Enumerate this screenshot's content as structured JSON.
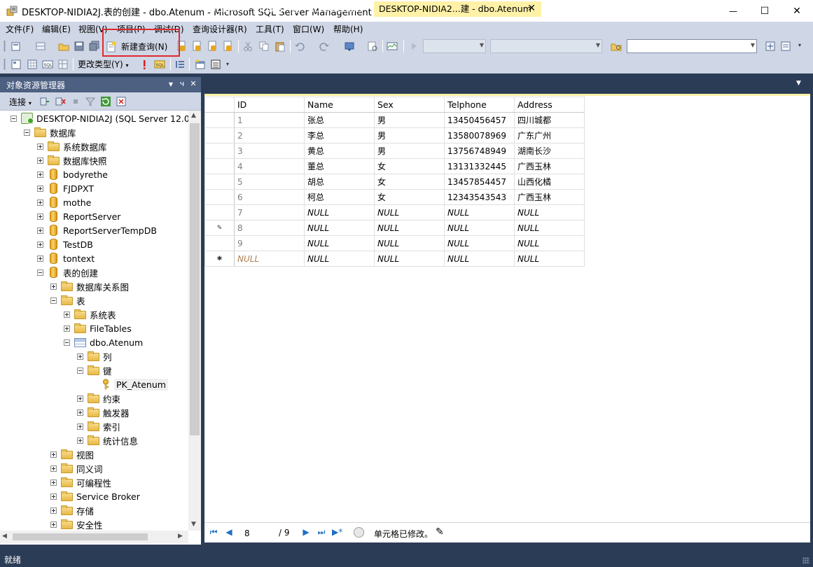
{
  "window": {
    "title": "DESKTOP-NIDIA2J.表的创建 - dbo.Atenum - Microsoft SQL Server Management Studio",
    "minimize": "—",
    "maximize": "☐",
    "close": "✕"
  },
  "menu": [
    "文件(F)",
    "编辑(E)",
    "视图(V)",
    "项目(P)",
    "调试(D)",
    "查询设计器(R)",
    "工具(T)",
    "窗口(W)",
    "帮助(H)"
  ],
  "toolbar": {
    "new_query": "新建查询(N)",
    "change_type": "更改类型(Y)"
  },
  "object_explorer": {
    "title": "对象资源管理器",
    "connect": "连接",
    "pin": "ч",
    "close": "✕",
    "server": "DESKTOP-NIDIA2J (SQL Server 12.0.2",
    "databases": "数据库",
    "system_databases": "系统数据库",
    "db_snapshots": "数据库快照",
    "db_list": [
      "bodyrethe",
      "FJDPXT",
      "mothe",
      "ReportServer",
      "ReportServerTempDB",
      "TestDB",
      "tontext"
    ],
    "current_db": "表的创建",
    "db_diagrams": "数据库关系图",
    "tables": "表",
    "system_tables": "系统表",
    "file_tables": "FileTables",
    "table_name": "dbo.Atenum",
    "columns": "列",
    "keys": "键",
    "pk": "PK_Atenum",
    "constraints": "约束",
    "triggers": "触发器",
    "indexes": "索引",
    "statistics": "统计信息",
    "views": "视图",
    "synonyms": "同义词",
    "programmability": "可编程性",
    "service_broker": "Service Broker",
    "storage": "存储",
    "security": "安全性"
  },
  "tabs": {
    "inactive": "DESKTOP-NIDIA2...建 - dbo.Atenum",
    "active": "DESKTOP-NIDIA2...建 - dbo.Atenum"
  },
  "grid": {
    "columns": [
      "ID",
      "Name",
      "Sex",
      "Telphone",
      "Address"
    ],
    "rows": [
      {
        "marker": "",
        "cells": [
          "1",
          "张总",
          "男",
          "13450456457",
          "四川城都"
        ]
      },
      {
        "marker": "",
        "cells": [
          "2",
          "李总",
          "男",
          "13580078969",
          "广东广州"
        ]
      },
      {
        "marker": "",
        "cells": [
          "3",
          "黄总",
          "男",
          "13756748949",
          "湖南长沙"
        ]
      },
      {
        "marker": "",
        "cells": [
          "4",
          "董总",
          "女",
          "13131332445",
          "广西玉林"
        ]
      },
      {
        "marker": "",
        "cells": [
          "5",
          "胡总",
          "女",
          "13457854457",
          "山西化橘"
        ]
      },
      {
        "marker": "",
        "cells": [
          "6",
          "柯总",
          "女",
          "12343543543",
          "广西玉林"
        ]
      },
      {
        "marker": "",
        "cells": [
          "7",
          "NULL",
          "NULL",
          "NULL",
          "NULL"
        ]
      },
      {
        "marker": "✎",
        "cells": [
          "8",
          "NULL",
          "NULL",
          "NULL",
          "NULL"
        ]
      },
      {
        "marker": "",
        "cells": [
          "9",
          "NULL",
          "NULL",
          "NULL",
          "NULL"
        ]
      },
      {
        "marker": "✱",
        "cells": [
          "NULL",
          "NULL",
          "NULL",
          "NULL",
          "NULL"
        ]
      }
    ]
  },
  "navigation": {
    "current_row": "8",
    "total": "/ 9",
    "message": "单元格已修改。"
  },
  "status": "就绪",
  "colors": {
    "chrome": "#2b3c57",
    "toolbar": "#cfd6e5",
    "active_tab": "#fff2a8",
    "highlight": "#e0292e"
  }
}
